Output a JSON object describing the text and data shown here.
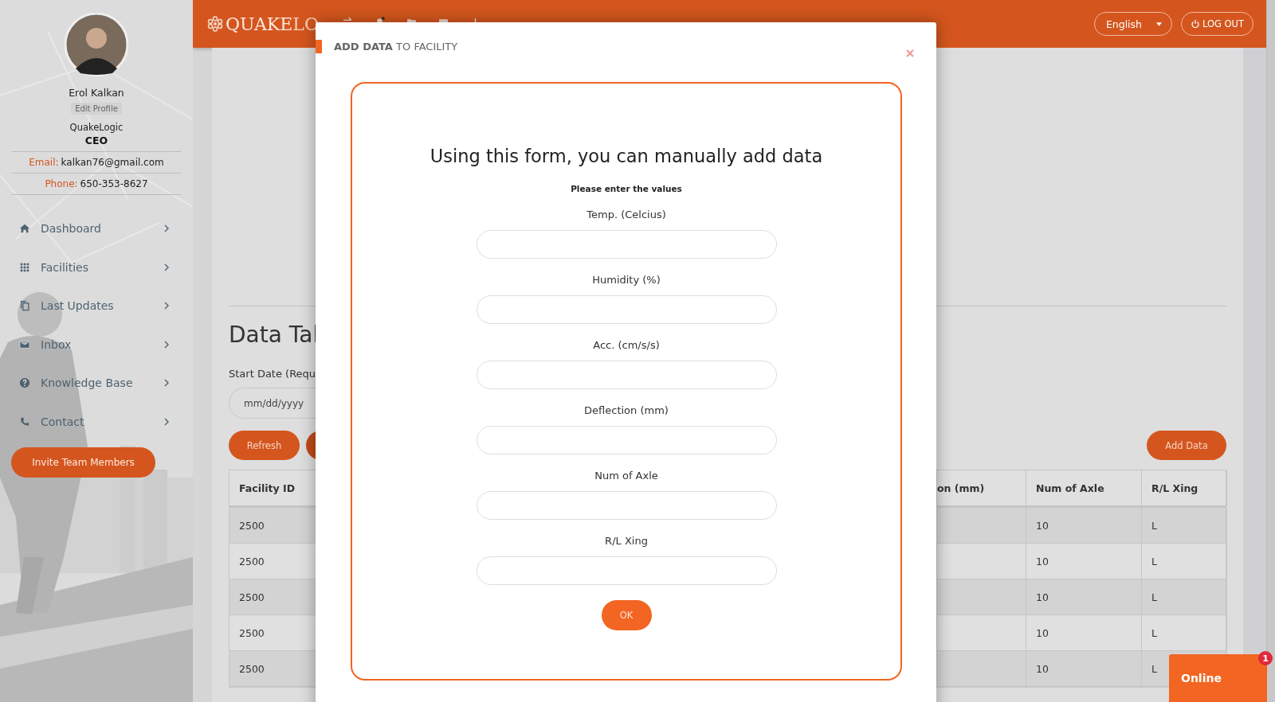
{
  "sidebar": {
    "profile": {
      "name": "Erol Kalkan",
      "edit_link": "Edit Profile",
      "company": "QuakeLogic",
      "role": "CEO",
      "email_label": "Email:",
      "email": "kalkan76@gmail.com",
      "phone_label": "Phone:",
      "phone": "650-353-8627"
    },
    "nav": [
      {
        "label": "Dashboard"
      },
      {
        "label": "Facilities"
      },
      {
        "label": "Last Updates"
      },
      {
        "label": "Inbox"
      },
      {
        "label": "Knowledge Base"
      },
      {
        "label": "Contact"
      }
    ],
    "invite_button": "Invite Team Members"
  },
  "header": {
    "logo_strong": "QUAKE",
    "logo_light": "LO",
    "language": "English",
    "logout": "LOG OUT"
  },
  "page": {
    "title": "Data Tal",
    "start_date_label": "Start Date (Requ",
    "date_placeholder": "mm/dd/yyyy",
    "refresh": "Refresh",
    "add_data": "Add Data"
  },
  "table": {
    "columns": [
      "Facility ID",
      "on (mm)",
      "Num of Axle",
      "R/L Xing"
    ],
    "rows": [
      [
        "2500",
        "",
        "10",
        "L"
      ],
      [
        "2500",
        "",
        "10",
        "L"
      ],
      [
        "2500",
        "",
        "10",
        "L"
      ],
      [
        "2500",
        "",
        "10",
        "L"
      ],
      [
        "2500",
        "",
        "10",
        "L"
      ]
    ]
  },
  "modal": {
    "title": "**ADD DATA** TO FACILITY",
    "heading": "Using this form, you can manually add data",
    "subheading": "Please enter the values",
    "fields": [
      {
        "label": "Temp. (Celcius)"
      },
      {
        "label": "Humidity (%)"
      },
      {
        "label": "Acc. (cm/s/s)"
      },
      {
        "label": "Deflection (mm)"
      },
      {
        "label": "Num of Axle"
      },
      {
        "label": "R/L Xing"
      }
    ],
    "ok": "OK"
  },
  "chat": {
    "label": "Online",
    "badge": "1"
  }
}
